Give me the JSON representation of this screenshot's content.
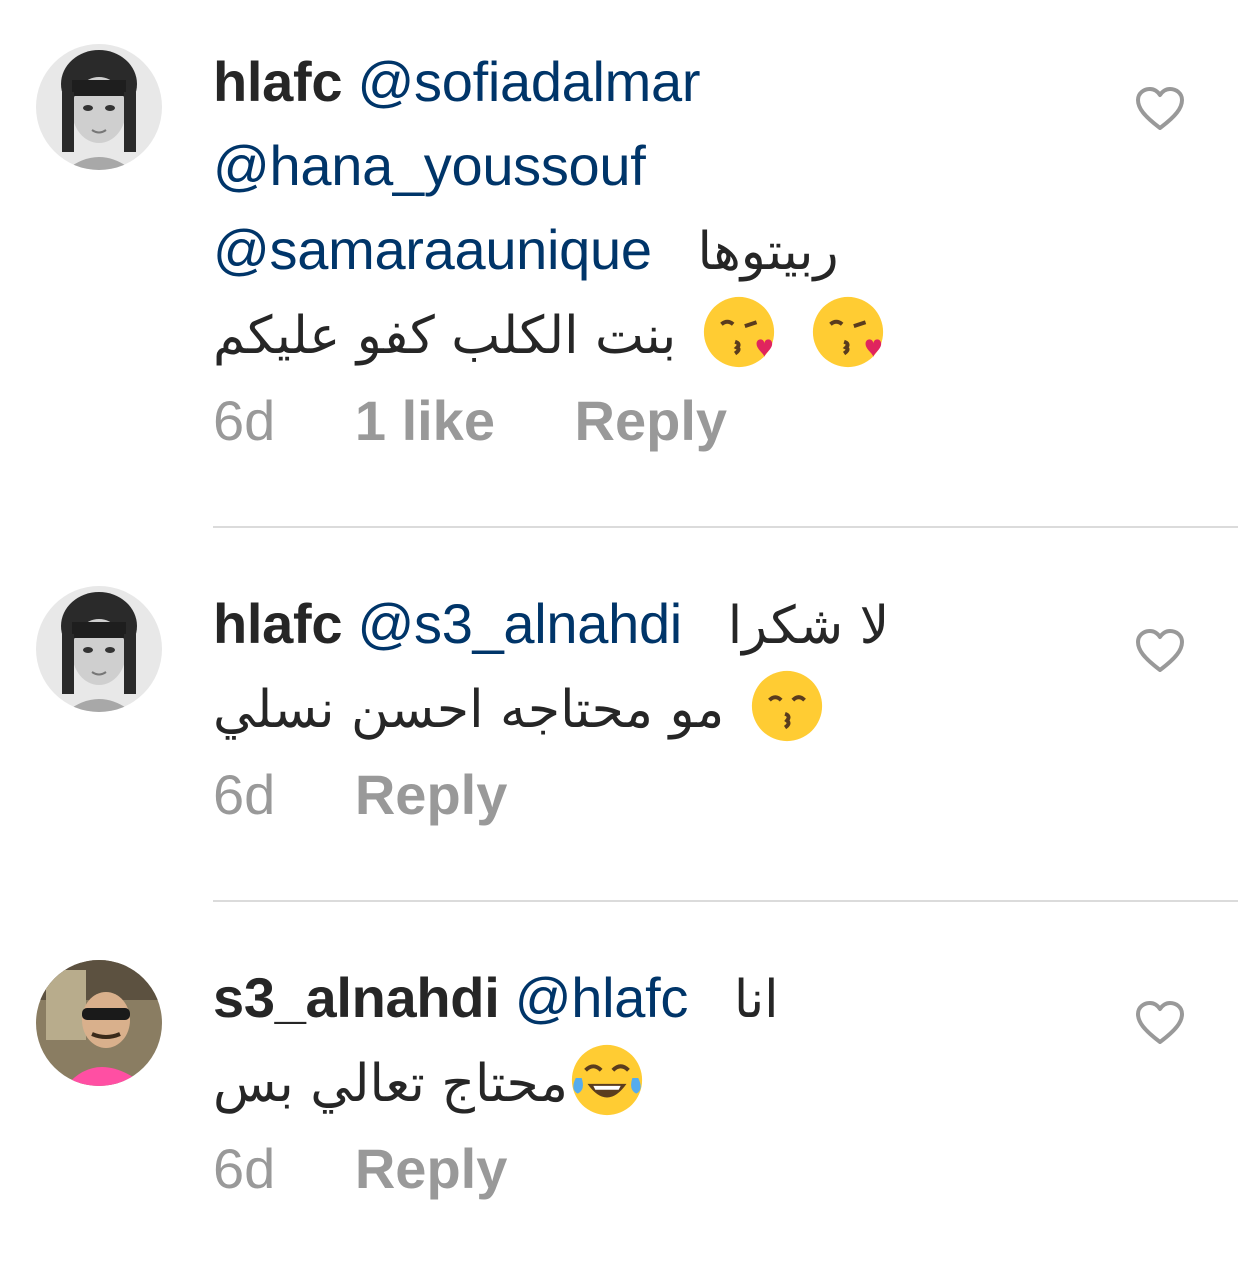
{
  "comments": [
    {
      "username": "hlafc",
      "line1_mention": "@sofiadalmar",
      "line2_mention": "@hana_youssouf",
      "line3_mention": "@samaraaunique",
      "line3_arabic": "ربيتوها",
      "line4_arabic": "بنت الكلب كفو عليكم",
      "line4_emoji": "kissing-heart-emoji",
      "time": "6d",
      "likes": "1 like",
      "reply": "Reply"
    },
    {
      "username": "hlafc",
      "line1_mention": "@s3_alnahdi",
      "line1_arabic": "لا شكرا",
      "line2_arabic": "مو محتاجه احسن نسلي",
      "line2_emoji": "kissing-smiling-eyes-emoji",
      "time": "6d",
      "reply": "Reply"
    },
    {
      "username": "s3_alnahdi",
      "line1_mention": "@hlafc",
      "line1_arabic": "انا",
      "line2_arabic": "محتاج تعالي بس",
      "line2_emoji": "tears-of-joy-emoji",
      "time": "6d",
      "reply": "Reply"
    }
  ],
  "colors": {
    "text": "#262626",
    "mention": "#003569",
    "meta": "#999999",
    "divider": "#dbdbdb",
    "heart": "#999999"
  }
}
